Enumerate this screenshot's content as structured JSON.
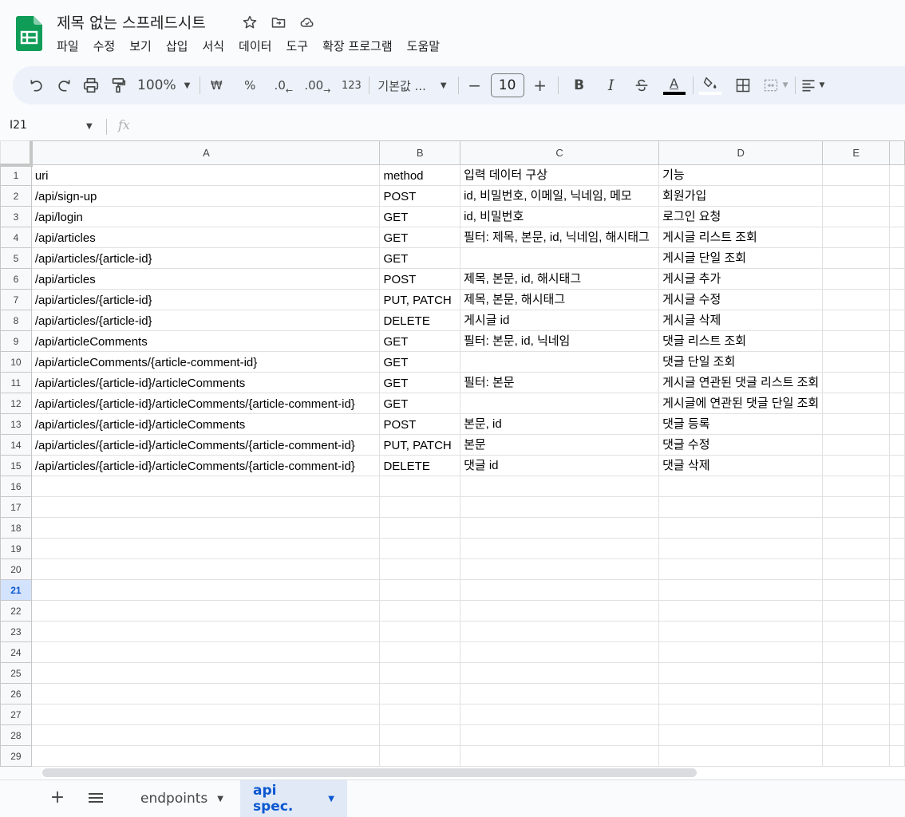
{
  "app": {
    "title": "제목 없는 스프레드시트",
    "menu": [
      "파일",
      "수정",
      "보기",
      "삽입",
      "서식",
      "데이터",
      "도구",
      "확장 프로그램",
      "도움말"
    ]
  },
  "toolbar": {
    "zoom": "100%",
    "currency": "₩",
    "percent": "%",
    "decrease_decimal": ".0",
    "increase_decimal": ".00",
    "number_format": "123",
    "font": "기본값 ...",
    "minus": "−",
    "font_size": "10",
    "plus": "+",
    "bold": "B",
    "italic": "I",
    "text_color_letter": "A"
  },
  "formula_bar": {
    "cell_ref": "I21",
    "fx": "fx"
  },
  "grid": {
    "columns": [
      "A",
      "B",
      "C",
      "D",
      "E"
    ],
    "active_row": 21,
    "row_count": 29,
    "rows": [
      [
        "uri",
        "method",
        "입력 데이터 구상",
        "기능",
        ""
      ],
      [
        "/api/sign-up",
        "POST",
        " id, 비밀번호, 이메일, 닉네임, 메모",
        "회원가입",
        ""
      ],
      [
        "/api/login",
        "GET",
        "id, 비밀번호",
        "로그인 요청",
        ""
      ],
      [
        "/api/articles",
        "GET",
        "필터: 제목, 본문, id, 닉네임, 해시태그",
        "게시글 리스트 조회",
        ""
      ],
      [
        "/api/articles/{article-id}",
        " GET",
        "",
        "게시글 단일 조회",
        ""
      ],
      [
        "/api/articles",
        "POST",
        "제목, 본문, id, 해시태그",
        "게시글 추가",
        ""
      ],
      [
        "/api/articles/{article-id}",
        "PUT, PATCH",
        "제목, 본문, 해시태그",
        "게시글 수정",
        ""
      ],
      [
        "/api/articles/{article-id}",
        "DELETE",
        "게시글 id",
        "게시글 삭제",
        ""
      ],
      [
        "/api/articleComments",
        "GET",
        "필터: 본문, id, 닉네임",
        "댓글 리스트 조회",
        ""
      ],
      [
        "/api/articleComments/{article-comment-id}",
        "GET",
        "",
        "댓글 단일 조회",
        ""
      ],
      [
        "/api/articles/{article-id}/articleComments",
        "GET",
        "필터: 본문",
        " 게시글 연관된 댓글 리스트 조회",
        ""
      ],
      [
        "/api/articles/{article-id}/articleComments/{article-comment-id}",
        "GET",
        "",
        "게시글에 연관된 댓글 단일 조회",
        ""
      ],
      [
        "/api/articles/{article-id}/articleComments",
        "POST",
        "본문, id",
        "댓글 등록",
        ""
      ],
      [
        "/api/articles/{article-id}/articleComments/{article-comment-id}",
        "PUT, PATCH",
        "본문",
        "댓글 수정",
        ""
      ],
      [
        "/api/articles/{article-id}/articleComments/{article-comment-id}",
        "DELETE",
        "댓글 id",
        "댓글 삭제",
        ""
      ]
    ]
  },
  "sheets": {
    "tabs": [
      {
        "label": "endpoints",
        "active": false
      },
      {
        "label": "api spec.",
        "active": true
      }
    ]
  },
  "colors": {
    "accent": "#0b57d0",
    "toolbar_bg": "#edf2fa",
    "active_tab_bg": "#e1e9f7",
    "logo_green": "#0f9d58"
  }
}
